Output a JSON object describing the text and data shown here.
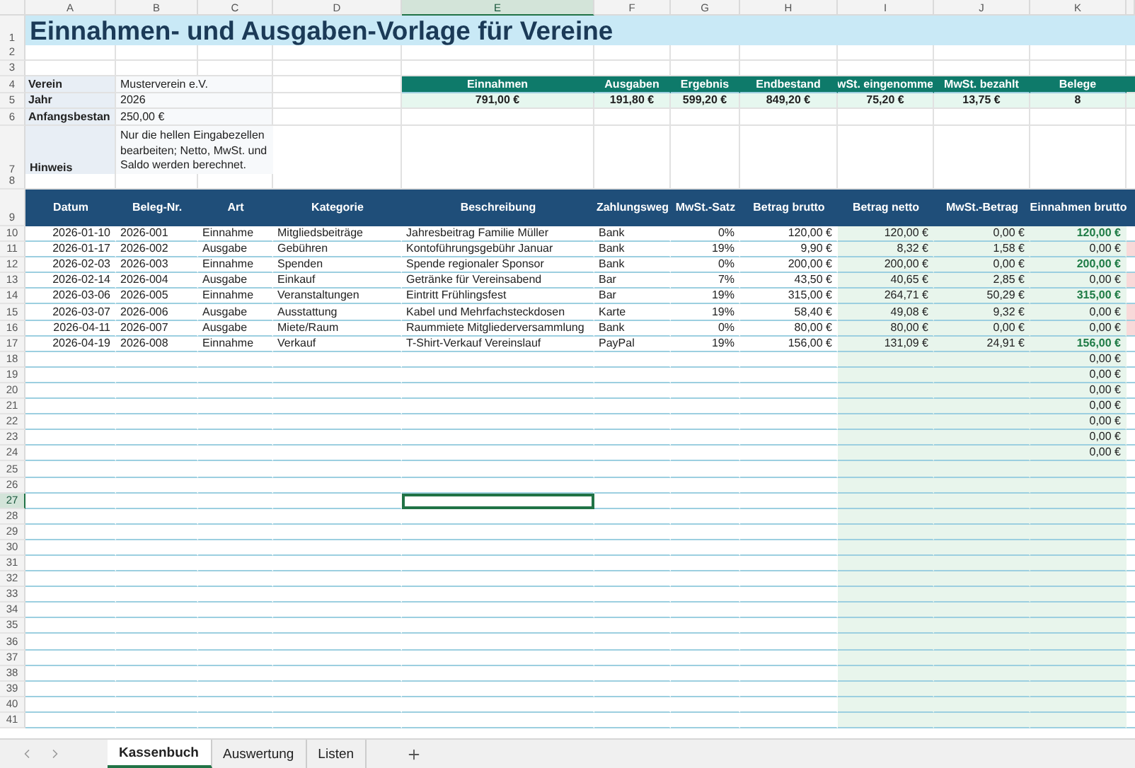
{
  "column_headers": [
    {
      "label": "A",
      "selected": false
    },
    {
      "label": "B",
      "selected": false
    },
    {
      "label": "C",
      "selected": false
    },
    {
      "label": "D",
      "selected": false
    },
    {
      "label": "E",
      "selected": true
    },
    {
      "label": "F",
      "selected": false
    },
    {
      "label": "G",
      "selected": false
    },
    {
      "label": "H",
      "selected": false
    },
    {
      "label": "I",
      "selected": false
    },
    {
      "label": "J",
      "selected": false
    },
    {
      "label": "K",
      "selected": false
    }
  ],
  "row_headers": [
    {
      "label": "1",
      "selected": false
    },
    {
      "label": "2",
      "selected": false
    },
    {
      "label": "3",
      "selected": false
    },
    {
      "label": "4",
      "selected": false
    },
    {
      "label": "5",
      "selected": false
    },
    {
      "label": "6",
      "selected": false
    },
    {
      "label": "7",
      "selected": false
    },
    {
      "label": "8",
      "selected": false
    },
    {
      "label": "9",
      "selected": false
    },
    {
      "label": "10",
      "selected": false
    },
    {
      "label": "11",
      "selected": false
    },
    {
      "label": "12",
      "selected": false
    },
    {
      "label": "13",
      "selected": false
    },
    {
      "label": "14",
      "selected": false
    },
    {
      "label": "15",
      "selected": false
    },
    {
      "label": "16",
      "selected": false
    },
    {
      "label": "17",
      "selected": false
    },
    {
      "label": "18",
      "selected": false
    },
    {
      "label": "19",
      "selected": false
    },
    {
      "label": "20",
      "selected": false
    },
    {
      "label": "21",
      "selected": false
    },
    {
      "label": "22",
      "selected": false
    },
    {
      "label": "23",
      "selected": false
    },
    {
      "label": "24",
      "selected": false
    },
    {
      "label": "25",
      "selected": false
    },
    {
      "label": "26",
      "selected": false
    },
    {
      "label": "27",
      "selected": true
    },
    {
      "label": "28",
      "selected": false
    },
    {
      "label": "29",
      "selected": false
    },
    {
      "label": "30",
      "selected": false
    },
    {
      "label": "31",
      "selected": false
    },
    {
      "label": "32",
      "selected": false
    },
    {
      "label": "33",
      "selected": false
    },
    {
      "label": "34",
      "selected": false
    },
    {
      "label": "35",
      "selected": false
    },
    {
      "label": "36",
      "selected": false
    },
    {
      "label": "37",
      "selected": false
    },
    {
      "label": "38",
      "selected": false
    },
    {
      "label": "39",
      "selected": false
    },
    {
      "label": "40",
      "selected": false
    },
    {
      "label": "41",
      "selected": false
    }
  ],
  "title": "Einnahmen- und Ausgaben-Vorlage für Vereine",
  "info": [
    {
      "label": "Verein",
      "value": "Musterverein e.V."
    },
    {
      "label": "Jahr",
      "value": "2026"
    },
    {
      "label": "Anfangsbestan",
      "value": "250,00 €"
    }
  ],
  "hint": {
    "label": "Hinweis",
    "text": "Nur die hellen Eingabezellen bearbeiten; Netto, MwSt. und Saldo werden berechnet."
  },
  "summary": [
    {
      "label": "Einnahmen",
      "value": "791,00 €"
    },
    {
      "label": "Ausgaben",
      "value": "191,80 €"
    },
    {
      "label": "Ergebnis",
      "value": "599,20 €"
    },
    {
      "label": "Endbestand",
      "value": "849,20 €"
    },
    {
      "label": "wSt. eingenomme",
      "value": "75,20 €"
    },
    {
      "label": "MwSt. bezahlt",
      "value": "13,75 €"
    },
    {
      "label": "Belege",
      "value": "8"
    }
  ],
  "table": {
    "columns": [
      "Datum",
      "Beleg-Nr.",
      "Art",
      "Kategorie",
      "Beschreibung",
      "Zahlungsweg",
      "MwSt.-Satz",
      "Betrag brutto",
      "Betrag netto",
      "MwSt.-Betrag",
      "Einnahmen brutto"
    ],
    "rows": [
      {
        "kind": "income",
        "cells": [
          "2026-01-10",
          "2026-001",
          "Einnahme",
          "Mitgliedsbeiträge",
          "Jahresbeitrag Familie Müller",
          "Bank",
          "0%",
          "120,00 €",
          "120,00 €",
          "0,00 €",
          "120,00 €"
        ]
      },
      {
        "kind": "expense",
        "cells": [
          "2026-01-17",
          "2026-002",
          "Ausgabe",
          "Gebühren",
          "Kontoführungsgebühr Januar",
          "Bank",
          "19%",
          "9,90 €",
          "8,32 €",
          "1,58 €",
          "0,00 €"
        ]
      },
      {
        "kind": "income",
        "cells": [
          "2026-02-03",
          "2026-003",
          "Einnahme",
          "Spenden",
          "Spende regionaler Sponsor",
          "Bank",
          "0%",
          "200,00 €",
          "200,00 €",
          "0,00 €",
          "200,00 €"
        ]
      },
      {
        "kind": "expense",
        "cells": [
          "2026-02-14",
          "2026-004",
          "Ausgabe",
          "Einkauf",
          "Getränke für Vereinsabend",
          "Bar",
          "7%",
          "43,50 €",
          "40,65 €",
          "2,85 €",
          "0,00 €"
        ]
      },
      {
        "kind": "income",
        "cells": [
          "2026-03-06",
          "2026-005",
          "Einnahme",
          "Veranstaltungen",
          "Eintritt Frühlingsfest",
          "Bar",
          "19%",
          "315,00 €",
          "264,71 €",
          "50,29 €",
          "315,00 €"
        ]
      },
      {
        "kind": "expense",
        "cells": [
          "2026-03-07",
          "2026-006",
          "Ausgabe",
          "Ausstattung",
          "Kabel und Mehrfachsteckdosen",
          "Karte",
          "19%",
          "58,40 €",
          "49,08 €",
          "9,32 €",
          "0,00 €"
        ]
      },
      {
        "kind": "expense",
        "cells": [
          "2026-04-11",
          "2026-007",
          "Ausgabe",
          "Miete/Raum",
          "Raummiete Mitgliederversammlung",
          "Bank",
          "0%",
          "80,00 €",
          "80,00 €",
          "0,00 €",
          "0,00 €"
        ]
      },
      {
        "kind": "income",
        "cells": [
          "2026-04-19",
          "2026-008",
          "Einnahme",
          "Verkauf",
          "T-Shirt-Verkauf Vereinslauf",
          "PayPal",
          "19%",
          "156,00 €",
          "131,09 €",
          "24,91 €",
          "156,00 €"
        ]
      }
    ],
    "blank_totals": [
      "0,00 €",
      "0,00 €",
      "0,00 €",
      "0,00 €",
      "0,00 €",
      "0,00 €",
      "0,00 €"
    ]
  },
  "sheet_tabs": [
    {
      "label": "Kassenbuch",
      "selected": true
    },
    {
      "label": "Auswertung",
      "selected": false
    },
    {
      "label": "Listen",
      "selected": false
    }
  ]
}
